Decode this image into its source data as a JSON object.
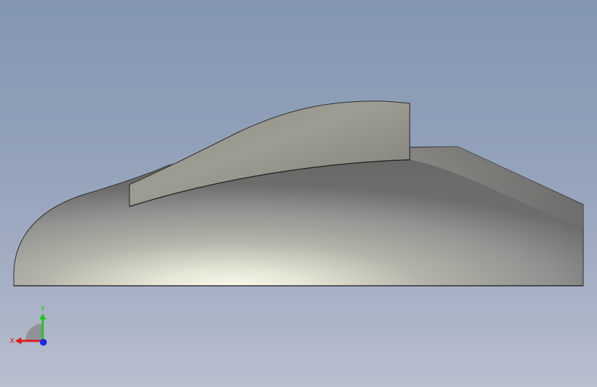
{
  "viewport": {
    "background_top": "#8396b1",
    "background_bottom": "#b8bfcf"
  },
  "model": {
    "body_color": "#9c9c94",
    "highlight_color": "#f4f4e6",
    "edge_color": "#2b2b2b"
  },
  "triad": {
    "x_label": "X",
    "y_label": "Y",
    "x_color": "#e01818",
    "y_color": "#22c422",
    "z_color": "#1a2ae0"
  }
}
